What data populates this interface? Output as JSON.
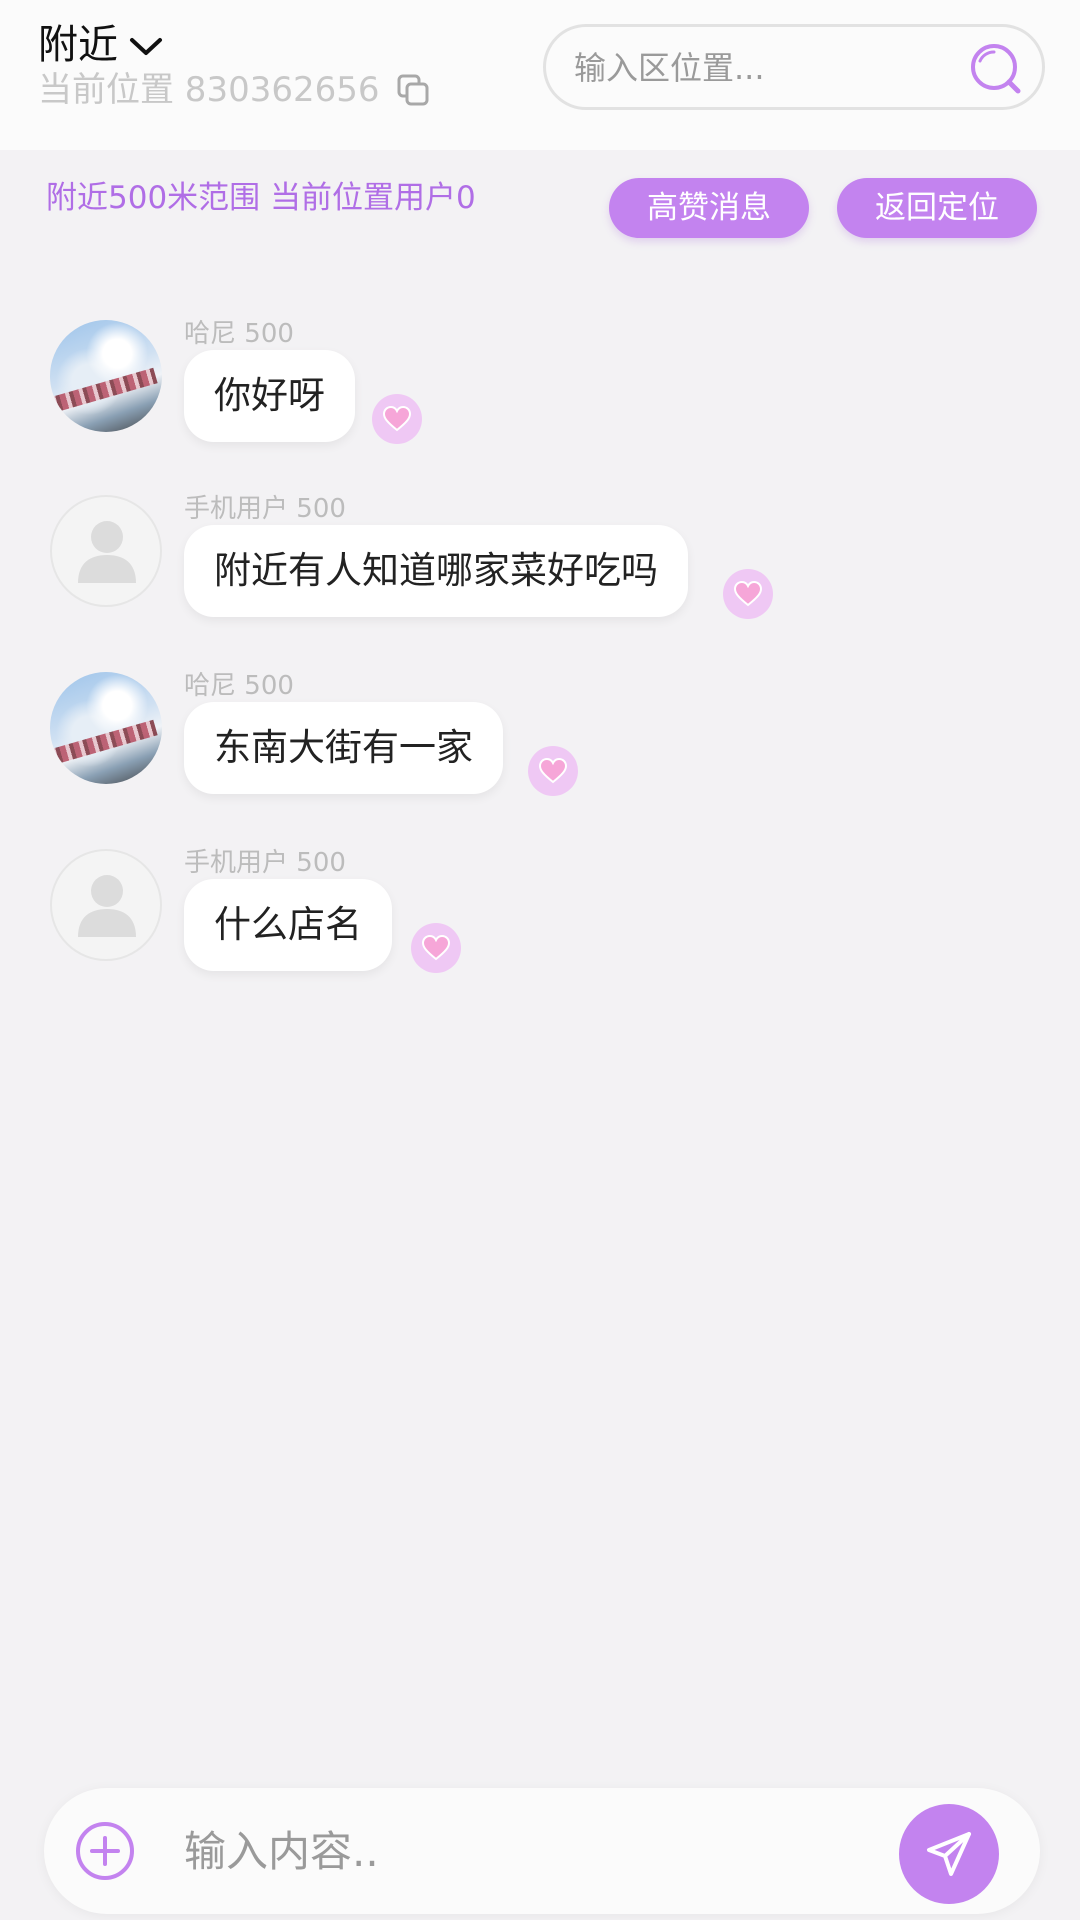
{
  "header": {
    "title": "附近",
    "location_label": "当前位置 830362656",
    "search_placeholder": "输入区位置..."
  },
  "info_bar": {
    "range_text": "附近500米范围 当前位置用户0",
    "hot_button": "高赞消息",
    "relocate_button": "返回定位"
  },
  "messages": [
    {
      "user": "哈尼",
      "distance": "500",
      "text": "你好呀",
      "avatar": "photo"
    },
    {
      "user": "手机用户",
      "distance": "500",
      "text": "附近有人知道哪家菜好吃吗",
      "avatar": "default"
    },
    {
      "user": "哈尼",
      "distance": "500",
      "text": "东南大街有一家",
      "avatar": "photo"
    },
    {
      "user": "手机用户",
      "distance": "500",
      "text": "什么店名",
      "avatar": "default"
    }
  ],
  "composer": {
    "placeholder": "输入内容.."
  },
  "colors": {
    "accent": "#c383ef",
    "accent_text": "#b06ee6",
    "background": "#f3f2f4"
  },
  "icons": [
    "chevron-down-icon",
    "copy-icon",
    "search-icon",
    "heart-icon",
    "plus-circle-icon",
    "send-icon",
    "default-avatar-icon"
  ]
}
